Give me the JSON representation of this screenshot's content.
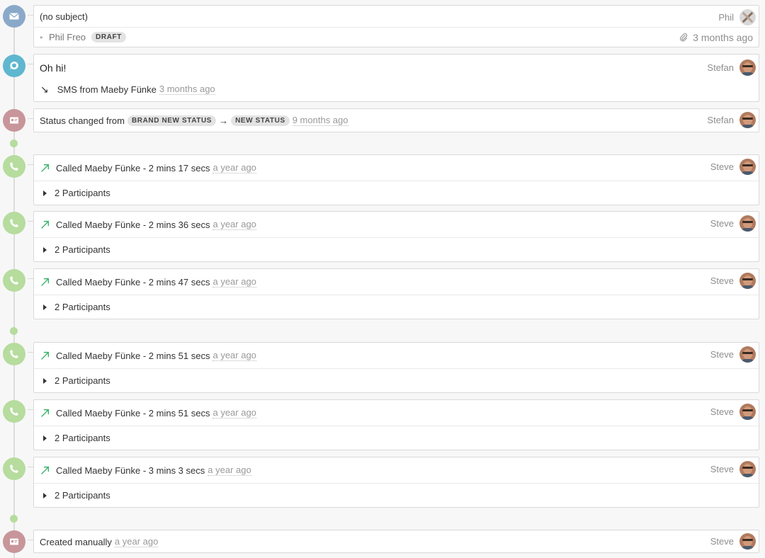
{
  "email": {
    "subject": "(no subject)",
    "user": "Phil",
    "from": "Phil Freo",
    "badge": "DRAFT",
    "time": "3 months ago"
  },
  "sms": {
    "body": "Oh hi!",
    "user": "Stefan",
    "label": "SMS from Maeby Fünke",
    "time": "3 months ago"
  },
  "status_change": {
    "prefix": "Status changed from",
    "from_status": "BRAND NEW STATUS",
    "arrow": "→",
    "to_status": "NEW STATUS",
    "time": "9 months ago",
    "user": "Stefan"
  },
  "calls": [
    {
      "text": "Called Maeby Fünke - 2 mins 17 secs",
      "time": "a year ago",
      "user": "Steve",
      "participants": "2 Participants"
    },
    {
      "text": "Called Maeby Fünke - 2 mins 36 secs",
      "time": "a year ago",
      "user": "Steve",
      "participants": "2 Participants"
    },
    {
      "text": "Called Maeby Fünke - 2 mins 47 secs",
      "time": "a year ago",
      "user": "Steve",
      "participants": "2 Participants"
    },
    {
      "text": "Called Maeby Fünke - 2 mins 51 secs",
      "time": "a year ago",
      "user": "Steve",
      "participants": "2 Participants"
    },
    {
      "text": "Called Maeby Fünke - 2 mins 51 secs",
      "time": "a year ago",
      "user": "Steve",
      "participants": "2 Participants"
    },
    {
      "text": "Called Maeby Fünke - 3 mins 3 secs",
      "time": "a year ago",
      "user": "Steve",
      "participants": "2 Participants"
    }
  ],
  "created": {
    "text": "Created manually",
    "time": "a year ago",
    "user": "Steve"
  },
  "colors": {
    "email_icon": "#8aa9c9",
    "sms_icon": "#5fb7cf",
    "lead_icon": "#c8959a",
    "call_icon": "#b6dc9e",
    "outgoing_arrow": "#3bb36b"
  },
  "icons": {
    "email": "envelope-icon",
    "sms": "chat-bubble-icon",
    "lead": "id-card-icon",
    "call": "phone-icon"
  }
}
